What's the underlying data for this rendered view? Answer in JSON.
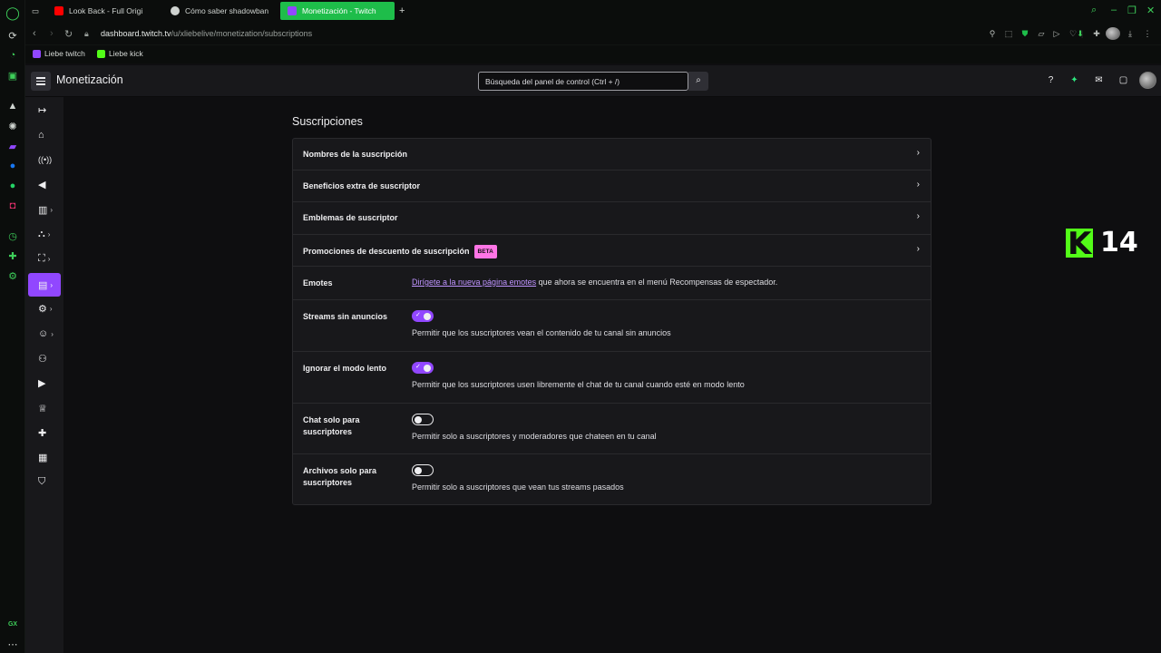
{
  "browser": {
    "tabs": [
      {
        "label": "Look Back - Full Origi",
        "fav_color": "#ff0000"
      },
      {
        "label": "Cómo saber shadowban",
        "fav_color": "#cfd3d0"
      },
      {
        "label": "Monetización - Twitch",
        "fav_color": "#9147ff"
      }
    ],
    "new_tab": "+",
    "url_host": "dashboard.twitch.tv",
    "url_path": "/u/xliebelive/monetization/subscriptions",
    "bookmarks": [
      {
        "label": "Liebe twitch",
        "color": "#9147ff"
      },
      {
        "label": "Liebe kick",
        "color": "#53fc18"
      }
    ],
    "gx_label": "GX"
  },
  "header": {
    "title": "Monetización",
    "search_placeholder": "Búsqueda del panel de control (Ctrl + /)"
  },
  "page": {
    "title": "Suscripciones",
    "nav_rows": [
      {
        "label": "Nombres de la suscripción"
      },
      {
        "label": "Beneficios extra de suscriptor"
      },
      {
        "label": "Emblemas de suscriptor"
      },
      {
        "label": "Promociones de descuento de suscripción",
        "badge": "BETA"
      }
    ],
    "emotes": {
      "label": "Emotes",
      "link": "Dirígete a la nueva página emotes",
      "rest": " que ahora se encuentra en el menú Recompensas de espectador."
    },
    "settings": [
      {
        "label": "Streams sin anuncios",
        "on": true,
        "desc": "Permitir que los suscriptores vean el contenido de tu canal sin anuncios"
      },
      {
        "label": "Ignorar el modo lento",
        "on": true,
        "desc": "Permitir que los suscriptores usen libremente el chat de tu canal cuando esté en modo lento"
      },
      {
        "label": "Chat solo para suscriptores",
        "on": false,
        "desc": "Permitir solo a suscriptores y moderadores que chateen en tu canal"
      },
      {
        "label": "Archivos solo para suscriptores",
        "on": false,
        "desc": "Permitir solo a suscriptores que vean tus streams pasados"
      }
    ]
  },
  "overlay": {
    "kick_count": "14"
  }
}
